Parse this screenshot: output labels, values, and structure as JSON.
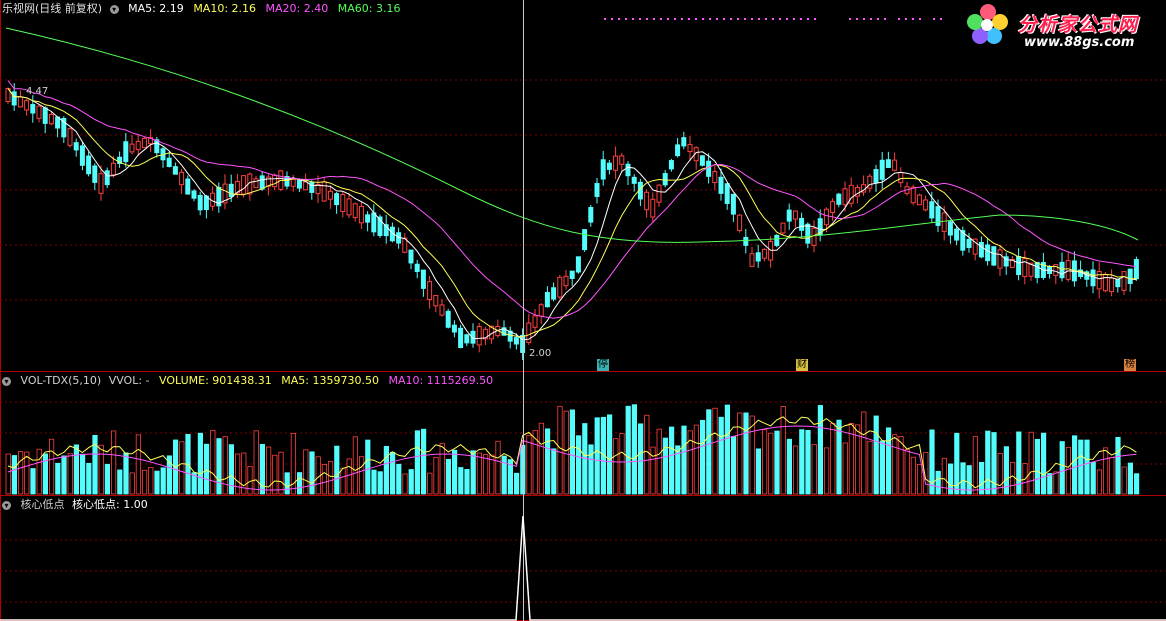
{
  "main_pane": {
    "title": "乐视网(日线 前复权)",
    "indicators": [
      {
        "label": "MA5: 2.19",
        "color": "#ffffff"
      },
      {
        "label": "MA10: 2.16",
        "color": "#ffff55"
      },
      {
        "label": "MA20: 2.40",
        "color": "#ff55ff"
      },
      {
        "label": "MA60: 3.16",
        "color": "#55ff55"
      }
    ],
    "price_high_label": "4.47",
    "price_low_label": "2.00",
    "event_markers": [
      "停",
      "财",
      "榜"
    ]
  },
  "volume_pane": {
    "title": "VOL-TDX(5,10)",
    "vvol": "VVOL: -",
    "volume": "VOLUME: 901438.31",
    "ma5": "MA5: 1359730.50",
    "ma10": "MA10: 1115269.50"
  },
  "signal_pane": {
    "title": "核心低点",
    "value": "核心低点: 1.00"
  },
  "logo": {
    "title": "分析家公式网",
    "url": "www.88gs.com"
  },
  "colors": {
    "up": "#ff4040",
    "down": "#54fcfc",
    "grid": "#800000",
    "ma5": "#ffffff",
    "ma10": "#ffff55",
    "ma20": "#ff55ff",
    "ma60": "#55ff55",
    "crosshair": "#c8c8c8"
  }
}
